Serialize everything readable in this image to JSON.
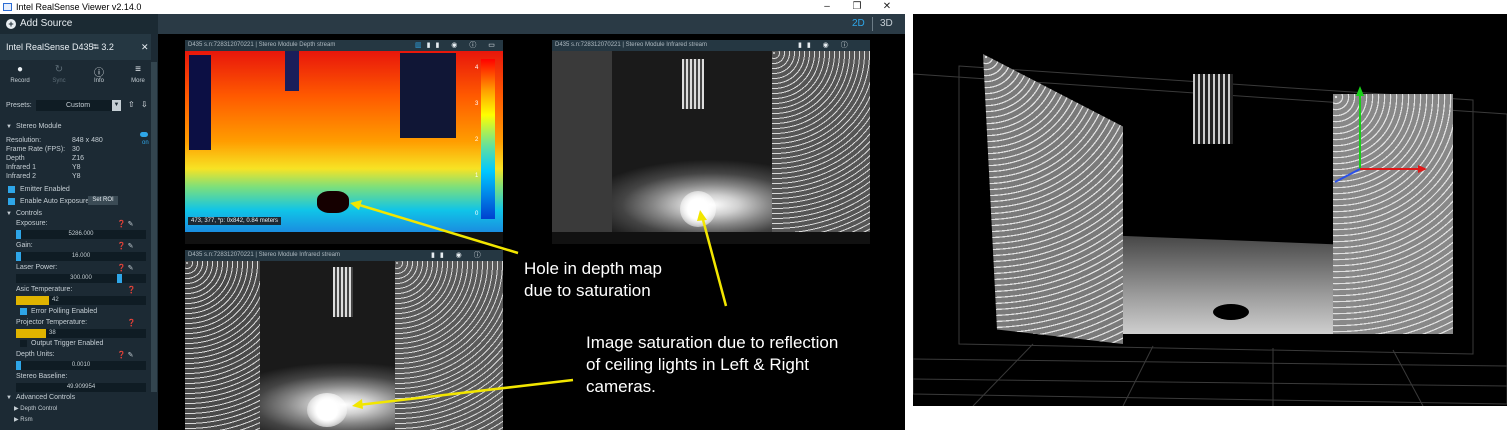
{
  "window": {
    "title": "Intel RealSense Viewer v2.14.0",
    "minimize": "–",
    "maximize": "❐",
    "close": "✕"
  },
  "toolbar": {
    "add_source": "Add Source",
    "mode_2d": "2D",
    "mode_3d": "3D"
  },
  "device": {
    "name": "Intel RealSense D435",
    "usb": "3.2",
    "tools": [
      {
        "label": "Record",
        "icon": "record-icon"
      },
      {
        "label": "Sync",
        "icon": "sync-icon"
      },
      {
        "label": "Info",
        "icon": "info-icon"
      },
      {
        "label": "More",
        "icon": "menu-icon"
      }
    ],
    "presets_label": "Presets:",
    "preset_value": "Custom",
    "module": "Stereo Module",
    "toggle_state": "on",
    "props": [
      {
        "k": "Resolution:",
        "v": "848 x 480"
      },
      {
        "k": "Frame Rate (FPS):",
        "v": "30"
      },
      {
        "k": "Depth",
        "v": "Z16"
      },
      {
        "k": "Infrared 1",
        "v": "Y8"
      },
      {
        "k": "Infrared 2",
        "v": "Y8"
      }
    ],
    "emitter": "Emitter Enabled",
    "auto_exposure": "Enable Auto Exposure",
    "set_roi": "Set ROI",
    "controls": "Controls",
    "exposure": {
      "label": "Exposure:",
      "value": "5286.000",
      "fraction": 0.04
    },
    "gain": {
      "label": "Gain:",
      "value": "16.000",
      "fraction": 0.04
    },
    "laser": {
      "label": "Laser Power:",
      "value": "300.000",
      "fraction": 0.78
    },
    "asic": {
      "label": "Asic Temperature:",
      "value": "42",
      "fraction": 0.25
    },
    "error_polling": "Error Polling Enabled",
    "projector": {
      "label": "Projector Temperature:",
      "value": "38",
      "fraction": 0.23
    },
    "output_trigger": "Output Trigger Enabled",
    "depth_units": {
      "label": "Depth Units:",
      "value": "0.0010",
      "fraction": 0.04
    },
    "stereo_baseline": {
      "label": "Stereo Baseline:",
      "value": "49.909954"
    },
    "advanced": "Advanced Controls",
    "adv_items": [
      "Depth Control",
      "Rsm"
    ]
  },
  "streams": {
    "depth": {
      "title": "D435 s.n:728312070221 | Stereo Module Depth stream",
      "readout": "473, 377, *p: 0x842, 0.84 meters",
      "scale": [
        "4",
        "3",
        "2",
        "1",
        "0"
      ]
    },
    "ir_right": {
      "title": "D435 s.n:728312070221 | Stereo Module Infrared stream"
    },
    "ir_bottom": {
      "title": "D435 s.n:728312070221 | Stereo Module Infrared stream"
    }
  },
  "annotations": {
    "hole_line1": "Hole in depth map",
    "hole_line2": "due to saturation",
    "sat_line1": "Image saturation due to reflection",
    "sat_line2": "of ceiling lights in Left & Right",
    "sat_line3": "cameras."
  },
  "colors": {
    "accent": "#2ea6e8",
    "arrow": "#f2e600",
    "sidebar": "#1c2a34",
    "slider_warn": "#e0b400"
  }
}
